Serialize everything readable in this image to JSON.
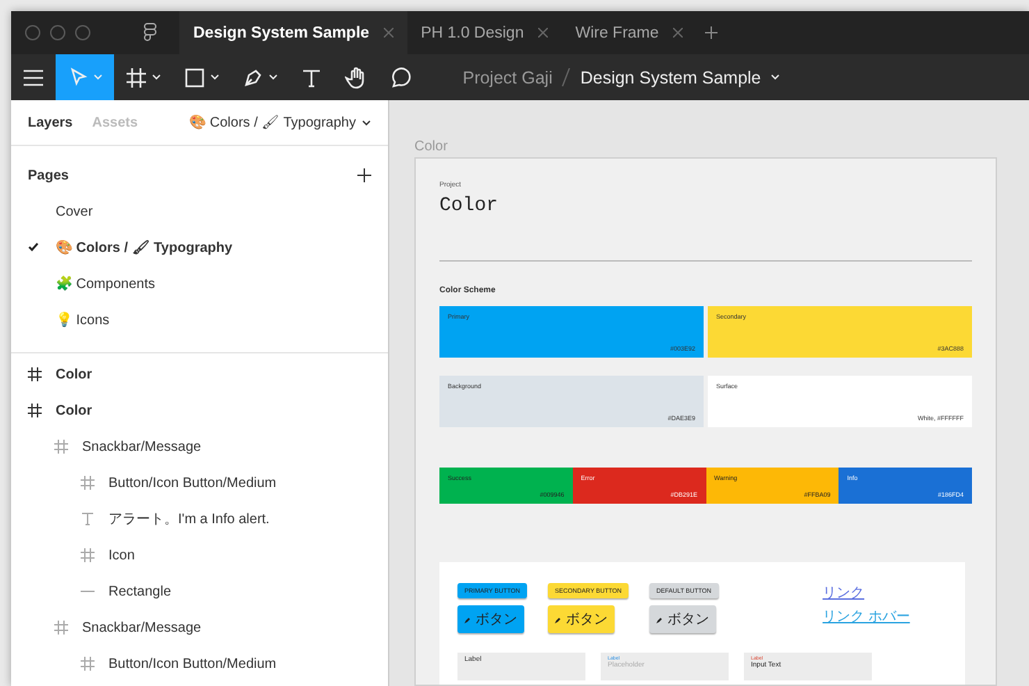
{
  "tabs": [
    {
      "label": "Design System Sample",
      "selected": true
    },
    {
      "label": "PH 1.0 Design",
      "selected": false
    },
    {
      "label": "Wire Frame",
      "selected": false
    }
  ],
  "toolbar": {
    "tools": [
      {
        "kind": "move",
        "selected": true,
        "menu": true
      },
      {
        "kind": "frame",
        "selected": false,
        "menu": true
      },
      {
        "kind": "shape",
        "selected": false,
        "menu": true
      },
      {
        "kind": "pen",
        "selected": false,
        "menu": true
      },
      {
        "kind": "text",
        "selected": false,
        "menu": false
      },
      {
        "kind": "hand",
        "selected": false,
        "menu": false
      },
      {
        "kind": "comment",
        "selected": false,
        "menu": false
      }
    ],
    "project": "Project Gaji",
    "file": "Design System Sample"
  },
  "sidebar": {
    "tabs": [
      {
        "label": "Layers",
        "selected": true
      },
      {
        "label": "Assets",
        "selected": false
      }
    ],
    "current_page": "🎨 Colors / 🖌 Typography",
    "pages_title": "Pages",
    "pages": [
      {
        "label": "Cover",
        "selected": false
      },
      {
        "label": "🎨 Colors / 🖌 Typography",
        "selected": true
      },
      {
        "label": "🧩 Components",
        "selected": false
      },
      {
        "label": "💡 Icons",
        "selected": false
      }
    ],
    "layers": [
      {
        "kind": "frame",
        "label": "Color"
      },
      {
        "kind": "frame",
        "label": "Color",
        "children": [
          {
            "kind": "component",
            "label": "Snackbar/Message",
            "children": [
              {
                "kind": "component",
                "label": "Button/Icon Button/Medium"
              },
              {
                "kind": "text",
                "label": "アラート。I'm a Info alert."
              },
              {
                "kind": "component",
                "label": "Icon"
              },
              {
                "kind": "line",
                "label": "Rectangle"
              }
            ]
          },
          {
            "kind": "component",
            "label": "Snackbar/Message",
            "children": [
              {
                "kind": "component",
                "label": "Button/Icon Button/Medium"
              }
            ]
          }
        ]
      }
    ]
  },
  "canvas": {
    "frame_label": "Color",
    "eyebrow": "Project",
    "title": "Color",
    "section": "Color Scheme",
    "scheme": [
      {
        "name": "Primary",
        "hex": "#003E92",
        "color": "#00a3f2"
      },
      {
        "name": "Secondary",
        "hex": "#3AC888",
        "color": "#fcd934"
      },
      {
        "name": "Background",
        "hex": "#DAE3E9",
        "color": "#dce3e9"
      },
      {
        "name": "Surface",
        "hex": "White, #FFFFFF",
        "color": "#ffffff"
      }
    ],
    "status": [
      {
        "name": "Success",
        "hex": "#009946",
        "color": "#00b24f"
      },
      {
        "name": "Error",
        "hex": "#DB291E",
        "color": "#dc291e"
      },
      {
        "name": "Warning",
        "hex": "#FFBA09",
        "color": "#fdb806"
      },
      {
        "name": "Info",
        "hex": "#186FD4",
        "color": "#1a70d5"
      }
    ],
    "buttons": [
      {
        "label": "PRIMARY BUTTON",
        "kind": "primary"
      },
      {
        "label": "SECONDARY BUTTON",
        "kind": "secondary"
      },
      {
        "label": "DEFAULT BUTTON",
        "kind": "default"
      }
    ],
    "icon_buttons": [
      {
        "label": "ボタン",
        "kind": "primary"
      },
      {
        "label": "ボタン",
        "kind": "secondary"
      },
      {
        "label": "ボタン",
        "kind": "default"
      }
    ],
    "links": [
      {
        "label": "リンク",
        "hover": false
      },
      {
        "label": "リンク ホバー",
        "hover": true
      }
    ],
    "fields": [
      {
        "label": "Label",
        "kind": "empty"
      },
      {
        "label": "Label",
        "placeholder": "Placeholder",
        "kind": "focused"
      },
      {
        "label": "Label",
        "value": "Input Text",
        "kind": "error"
      }
    ]
  }
}
